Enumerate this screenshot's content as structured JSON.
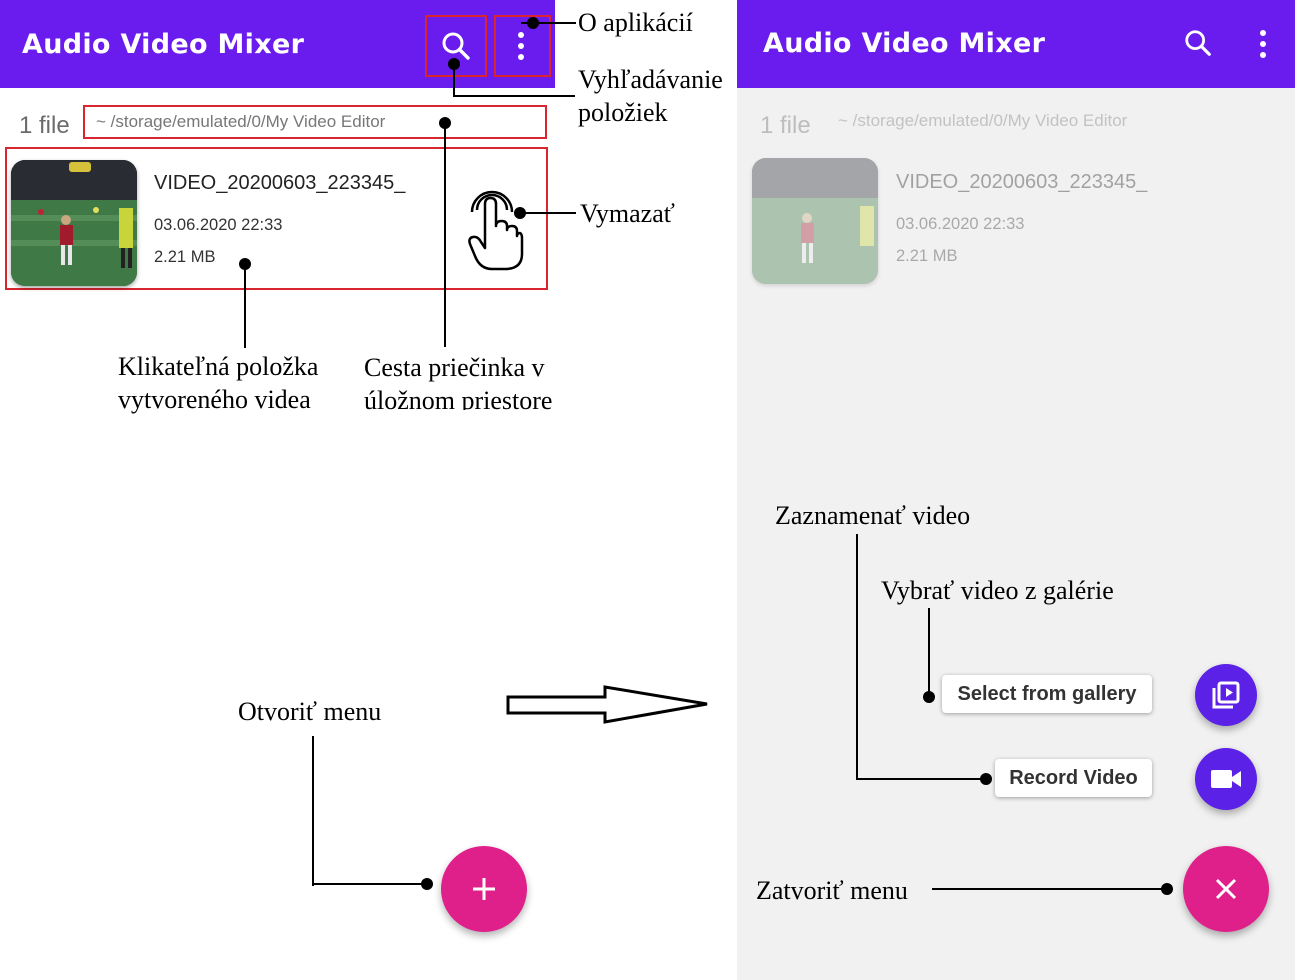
{
  "app": {
    "title": "Audio Video Mixer"
  },
  "list": {
    "file_count": "1 file",
    "folder_path": "~ /storage/emulated/0/My Video Editor",
    "item": {
      "name": "VIDEO_20200603_223345_",
      "date": "03.06.2020 22:33",
      "size": "2.21 MB"
    }
  },
  "menu": {
    "gallery_label": "Select from gallery",
    "record_label": "Record Video"
  },
  "annotations": {
    "about": "O aplikácií",
    "search_line1": "Vyhľadávanie",
    "search_line2": "položiek",
    "delete": "Vymazať",
    "item_line1": "Klikateľná položka",
    "item_line2": "vytvoreného videa",
    "path_line1": "Cesta priečinka v",
    "path_line2": "úložnom priestore",
    "open_menu": "Otvoriť menu",
    "record_video": "Zaznamenať video",
    "pick_gallery": "Vybrať video z galérie",
    "close_menu": "Zatvoriť menu"
  },
  "colors": {
    "appbar": "#6a1bee",
    "fab": "#e0208a",
    "mini_fab": "#5b21e6",
    "highlight_box": "#d9262e"
  },
  "icons": [
    "search-icon",
    "more-vert-icon",
    "touch-gesture-icon",
    "add-icon",
    "close-icon",
    "gallery-icon",
    "videocam-icon",
    "right-arrow-icon"
  ]
}
